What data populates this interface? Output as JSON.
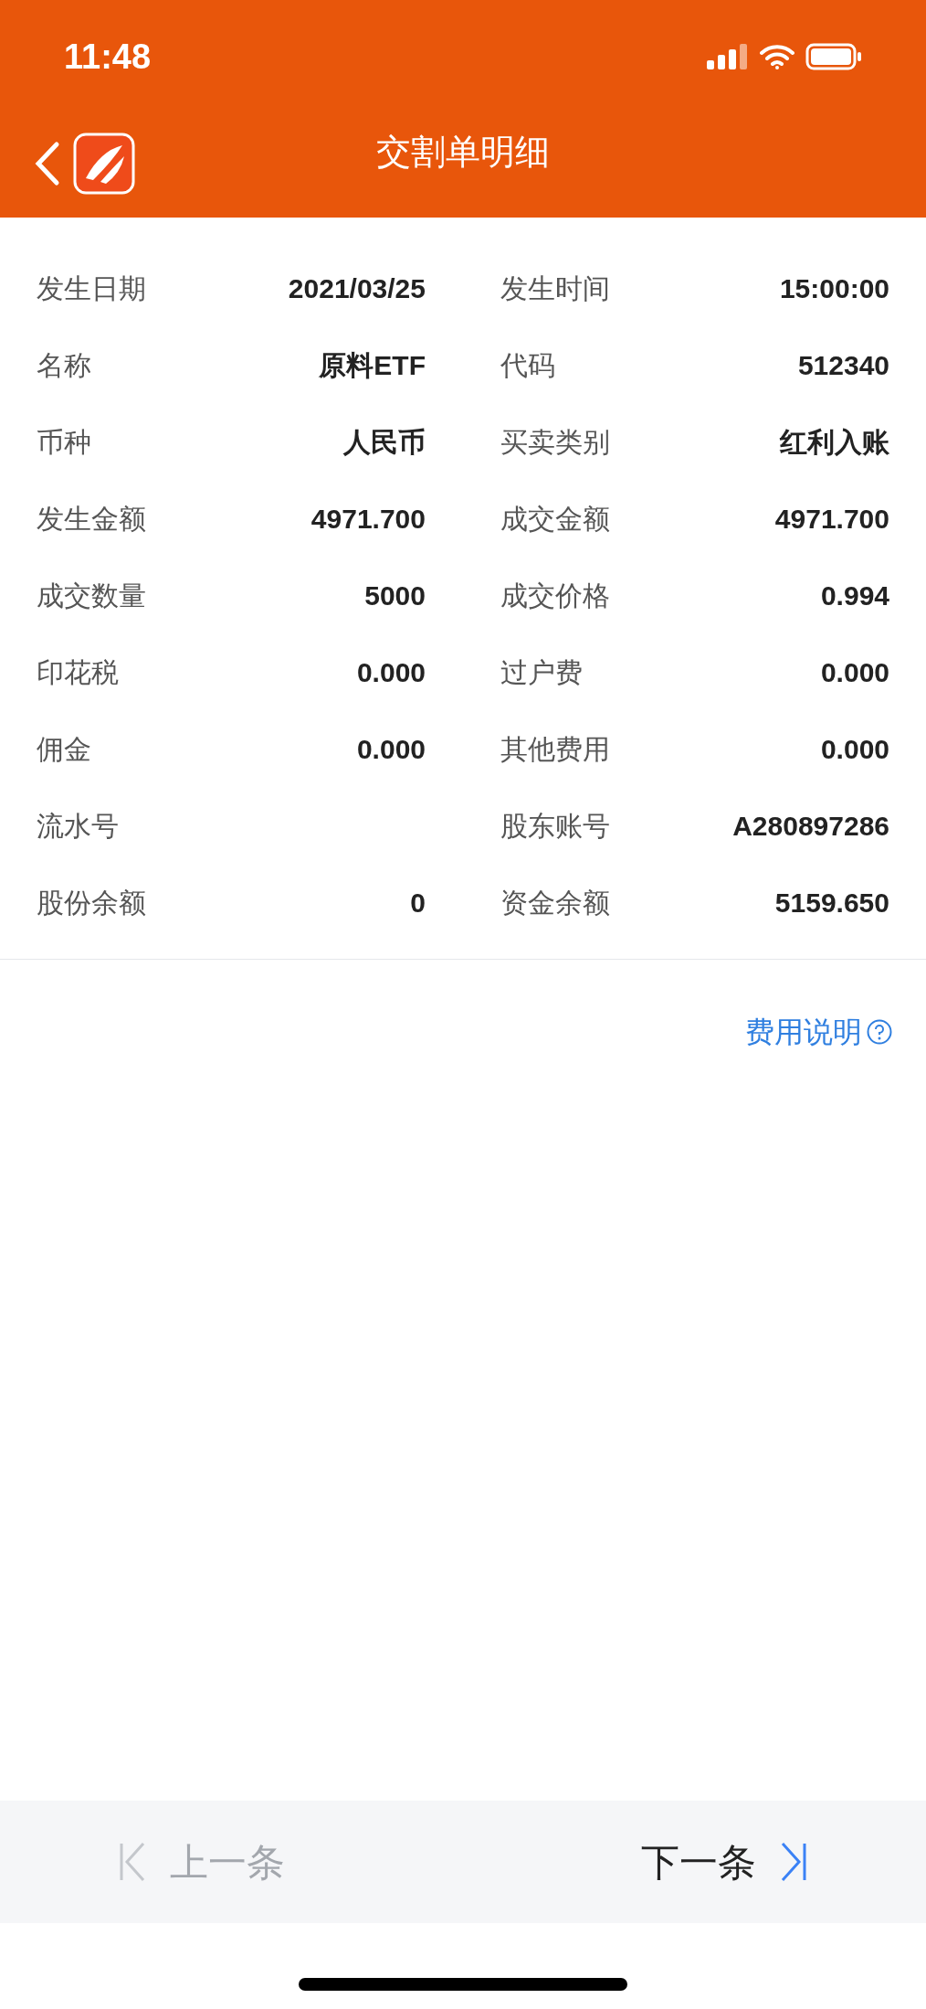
{
  "status_bar": {
    "time": "11:48"
  },
  "header": {
    "title": "交割单明细"
  },
  "details": [
    {
      "label": "发生日期",
      "value": "2021/03/25"
    },
    {
      "label": "发生时间",
      "value": "15:00:00"
    },
    {
      "label": "名称",
      "value": "原料ETF"
    },
    {
      "label": "代码",
      "value": "512340"
    },
    {
      "label": "币种",
      "value": "人民币"
    },
    {
      "label": "买卖类别",
      "value": "红利入账"
    },
    {
      "label": "发生金额",
      "value": "4971.700"
    },
    {
      "label": "成交金额",
      "value": "4971.700"
    },
    {
      "label": "成交数量",
      "value": "5000"
    },
    {
      "label": "成交价格",
      "value": "0.994"
    },
    {
      "label": "印花税",
      "value": "0.000"
    },
    {
      "label": "过户费",
      "value": "0.000"
    },
    {
      "label": "佣金",
      "value": "0.000"
    },
    {
      "label": "其他费用",
      "value": "0.000"
    },
    {
      "label": "流水号"
    },
    {
      "label": "股东账号",
      "value": "A280897286"
    },
    {
      "label": "股份余额",
      "value": "0"
    },
    {
      "label": "资金余额",
      "value": "5159.650"
    }
  ],
  "fee_link": "费用说明",
  "navigation": [
    {
      "kind": "prev",
      "label": "上一条",
      "disabled": true
    },
    {
      "kind": "next",
      "label": "下一条",
      "disabled": false
    }
  ]
}
